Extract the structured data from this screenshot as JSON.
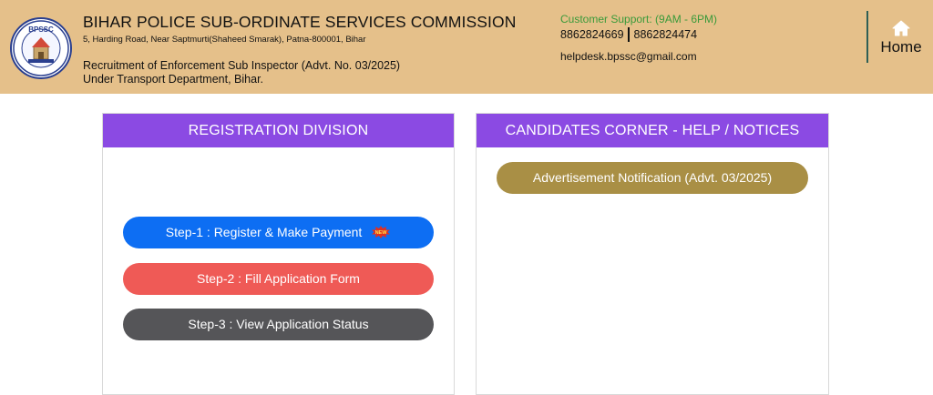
{
  "header": {
    "logo_text": "BPSSC",
    "title": "BIHAR POLICE SUB-ORDINATE SERVICES COMMISSION",
    "address": "5, Harding Road, Near Saptmurti(Shaheed Smarak), Patna-800001, Bihar",
    "recruitment_line1": "Recruitment of Enforcement Sub Inspector (Advt. No. 03/2025)",
    "recruitment_line2": "Under Transport Department, Bihar.",
    "support": {
      "title": "Customer Support: (9AM - 6PM)",
      "phone1": "8862824669",
      "phone2": "8862824474",
      "email": "helpdesk.bpssc@gmail.com"
    },
    "home_label": "Home"
  },
  "registration": {
    "heading": "REGISTRATION DIVISION",
    "step1": "Step-1 : Register & Make Payment",
    "new_badge": "NEW",
    "step2": "Step-2 : Fill Application Form",
    "step3": "Step-3 : View Application Status"
  },
  "candidates": {
    "heading": "CANDIDATES CORNER - HELP / NOTICES",
    "advt_button": "Advertisement Notification (Advt. 03/2025)"
  },
  "colors": {
    "header_bg": "#e5c08a",
    "panel_head": "#8b4ae3",
    "step1": "#0d6ef3",
    "step2": "#ef5a56",
    "step3": "#555558",
    "advt": "#a98f45",
    "support_green": "#3a9a3a"
  },
  "icons": {
    "logo": "bpssc-seal-icon",
    "home": "home-icon",
    "new": "new-badge-icon"
  }
}
